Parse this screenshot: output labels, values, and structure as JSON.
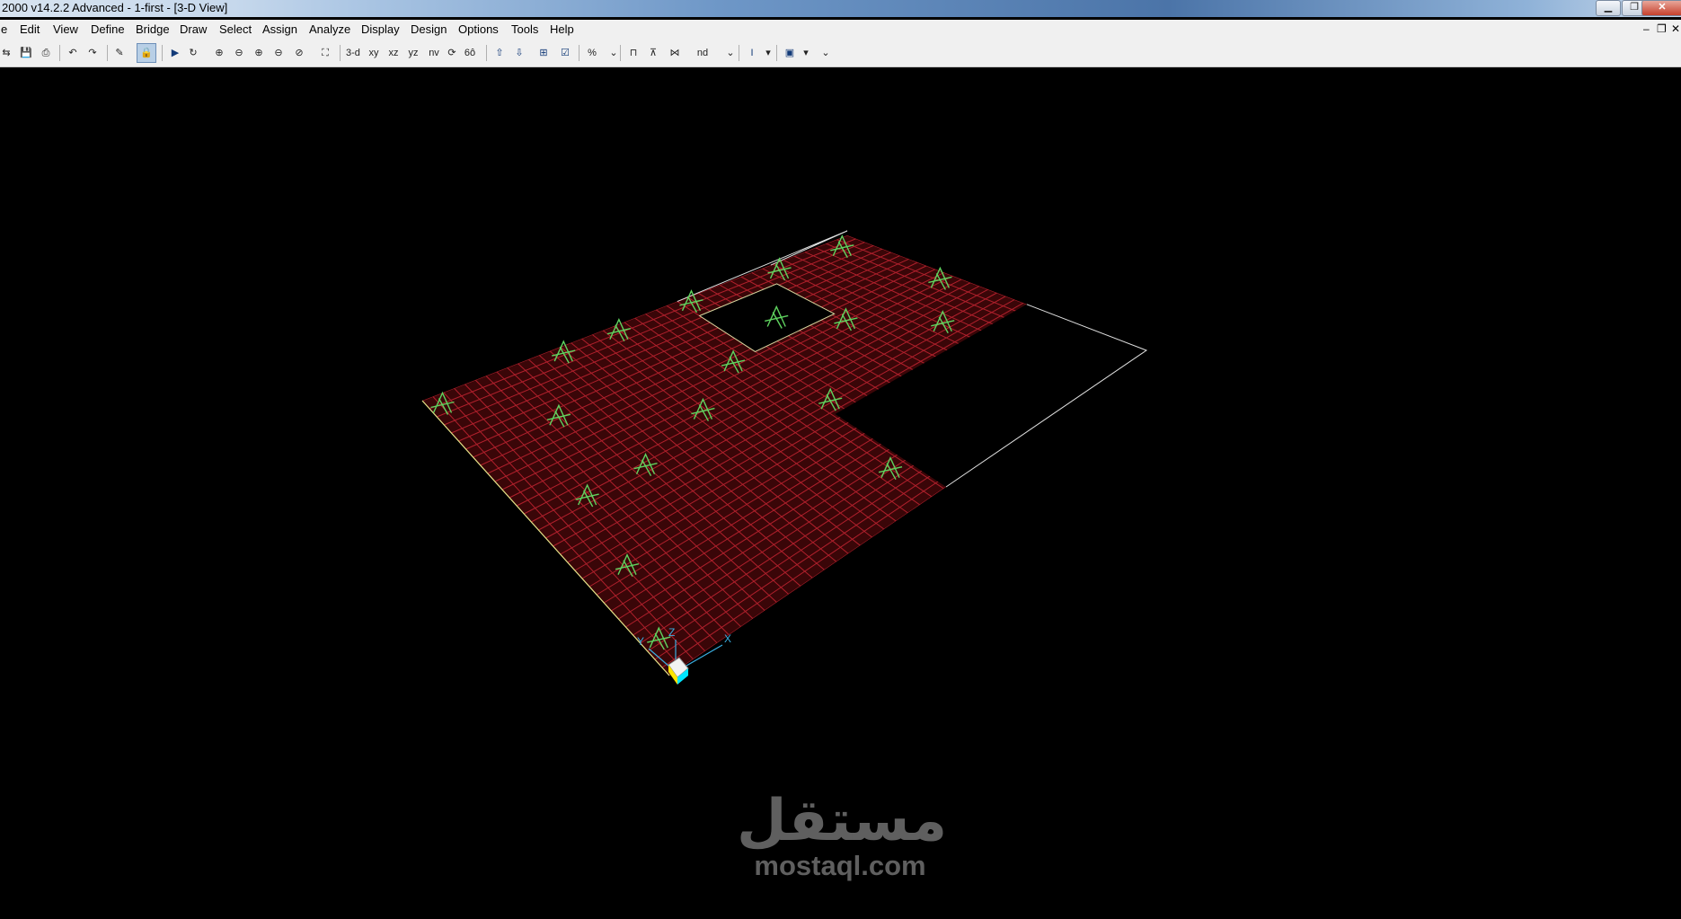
{
  "window": {
    "title": "2000 v14.2.2 Advanced  - 1-first - [3-D View]",
    "controls": [
      "minimize-icon",
      "maximize-icon",
      "close-icon"
    ],
    "controls_glyphs": [
      "▁",
      "❐",
      "✕"
    ]
  },
  "menu": {
    "items": [
      "e",
      "Edit",
      "View",
      "Define",
      "Bridge",
      "Draw",
      "Select",
      "Assign",
      "Analyze",
      "Display",
      "Design",
      "Options",
      "Tools",
      "Help"
    ],
    "mdi_glyphs": [
      "–",
      "❐",
      "✕"
    ]
  },
  "toolbar": {
    "buttons": [
      {
        "icon": "open-icon",
        "glyph": "⇆"
      },
      {
        "icon": "save-icon",
        "glyph": "💾"
      },
      {
        "icon": "print-icon",
        "glyph": "⎙"
      },
      {
        "icon": "undo-icon",
        "glyph": "↶"
      },
      {
        "icon": "redo-icon",
        "glyph": "↷"
      },
      {
        "icon": "pencil-icon",
        "glyph": "✎"
      },
      {
        "icon": "lock-icon",
        "glyph": "🔒"
      },
      {
        "icon": "run-icon",
        "glyph": "▶"
      },
      {
        "icon": "refresh-window-icon",
        "glyph": "↻"
      },
      {
        "icon": "zoom-window-icon",
        "glyph": "⊕"
      },
      {
        "icon": "zoom-fit-icon",
        "glyph": "⊖"
      },
      {
        "icon": "zoom-in-icon",
        "glyph": "⊕"
      },
      {
        "icon": "zoom-out-icon",
        "glyph": "⊖"
      },
      {
        "icon": "zoom-previous-icon",
        "glyph": "⊘"
      },
      {
        "icon": "pan-icon",
        "glyph": "⛶"
      },
      {
        "icon": "view-3d",
        "label": "3-d"
      },
      {
        "icon": "view-xy",
        "label": "xy"
      },
      {
        "icon": "view-xz",
        "label": "xz"
      },
      {
        "icon": "view-yz",
        "label": "yz"
      },
      {
        "icon": "view-nv",
        "label": "nv"
      },
      {
        "icon": "rotate-icon",
        "glyph": "⟳"
      },
      {
        "icon": "perspective-icon",
        "glyph": "6ô"
      },
      {
        "icon": "move-up-icon",
        "glyph": "⇧"
      },
      {
        "icon": "move-down-icon",
        "glyph": "⇩"
      },
      {
        "icon": "select-all-icon",
        "glyph": "⊞"
      },
      {
        "icon": "check-icon",
        "glyph": "☑"
      },
      {
        "icon": "percent-icon",
        "glyph": "%"
      },
      {
        "icon": "frame-icon",
        "glyph": "⊓"
      },
      {
        "icon": "truss-icon",
        "glyph": "⊼"
      },
      {
        "icon": "grid-icon",
        "glyph": "⋈"
      },
      {
        "icon": "nd-icon",
        "label": "nd"
      },
      {
        "icon": "section-icon",
        "glyph": "I"
      },
      {
        "icon": "display-icon",
        "glyph": "▣"
      }
    ]
  },
  "viewport": {
    "background": "#000000",
    "mesh_color": "#b0202c",
    "mesh_fill": "#3a0608",
    "support_color": "#5fd35f",
    "outline_color": "#e0e0e0",
    "axes": {
      "x_label": "X",
      "y_label": "Y",
      "z_label": "Z",
      "color": "#3aaee0"
    }
  },
  "watermark": {
    "arabic": "مستقل",
    "latin": "mostaql.com"
  }
}
